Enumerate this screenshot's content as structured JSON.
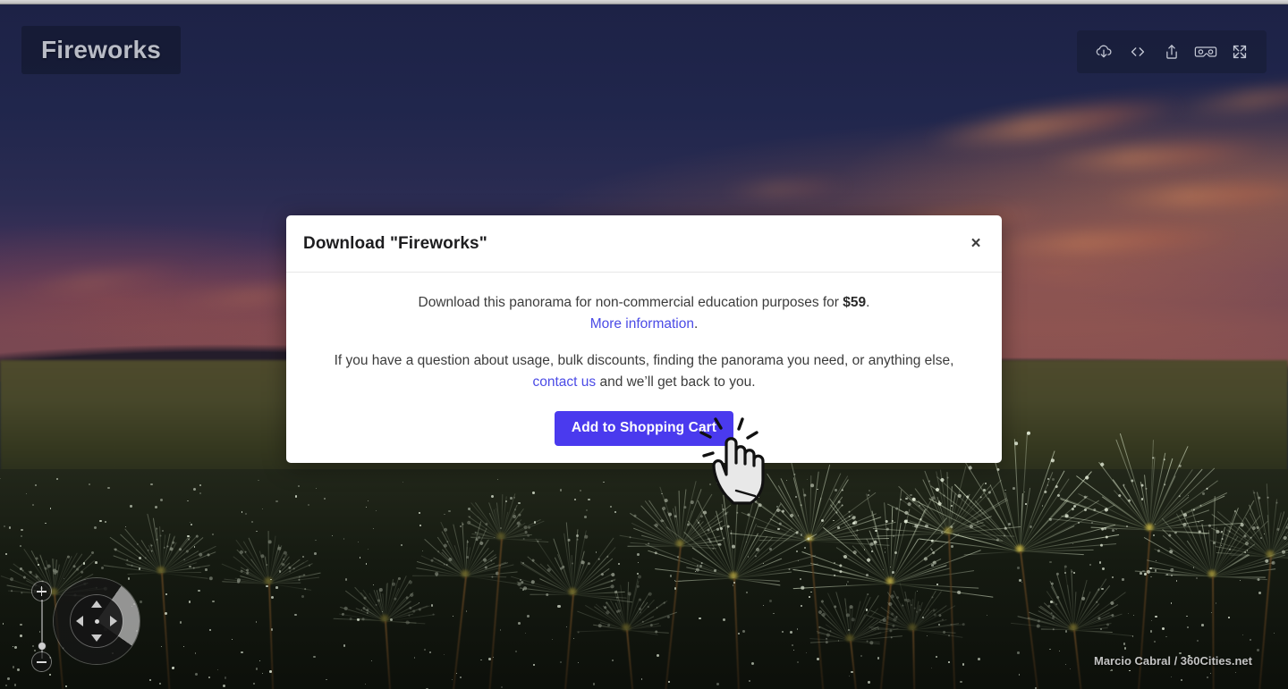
{
  "viewer": {
    "title": "Fireworks",
    "credit": "Marcio Cabral / 360Cities.net",
    "toolbar": [
      {
        "name": "download-cloud-icon",
        "label": "Download"
      },
      {
        "name": "embed-code-icon",
        "label": "Embed"
      },
      {
        "name": "share-icon",
        "label": "Share"
      },
      {
        "name": "vr-goggles-icon",
        "label": "View in VR"
      },
      {
        "name": "fullscreen-icon",
        "label": "Fullscreen"
      }
    ],
    "nav": {
      "zoom_in_label": "+",
      "zoom_out_label": "−",
      "pan_up_label": "Pan up",
      "pan_down_label": "Pan down",
      "pan_left_label": "Pan left",
      "pan_right_label": "Pan right"
    }
  },
  "modal": {
    "title": "Download \"Fireworks\"",
    "close_label": "×",
    "line1_before": "Download this panorama for non-commercial education purposes for ",
    "line1_price": "$59",
    "line1_after": ".",
    "more_info_link": "More information",
    "more_info_period": ".",
    "line2": "If you have a question about usage, bulk discounts, finding the panorama you need, or anything else,",
    "line3_link": "contact us",
    "line3_after": " and we’ll get back to you.",
    "cart_button": "Add to Shopping Cart"
  },
  "colors": {
    "accent": "#4a3aee",
    "link": "#4b4be6",
    "modal_bg": "#ffffff",
    "sky": "#1d2246",
    "badge_text": "#b9bcc6"
  }
}
